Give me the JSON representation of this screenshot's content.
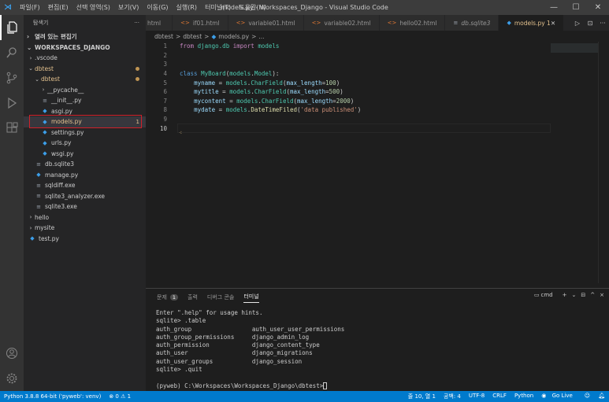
{
  "menubar": {
    "items": [
      "파일(F)",
      "편집(E)",
      "선택 영역(S)",
      "보기(V)",
      "이동(G)",
      "실행(R)",
      "터미널(T)",
      "도움말(H)"
    ],
    "window_title": "models.py - Workspaces_Django - Visual Studio Code"
  },
  "activity_icons": [
    "files-icon",
    "search-icon",
    "source-control-icon",
    "run-debug-icon",
    "extensions-icon",
    "account-icon",
    "settings-gear-icon"
  ],
  "sidebar": {
    "header": "탐색기",
    "more": "···",
    "open_editors": "열려 있는 편집기",
    "workspace": "WORKSPACES_DJANGO",
    "tree": [
      {
        "label": ".vscode",
        "indent": 1,
        "kind": "folder-closed"
      },
      {
        "label": "dbtest",
        "indent": 1,
        "kind": "folder-open",
        "modified": true
      },
      {
        "label": "dbtest",
        "indent": 2,
        "kind": "folder-open",
        "modified": true
      },
      {
        "label": "__pycache__",
        "indent": 3,
        "kind": "folder-closed"
      },
      {
        "label": "__init__.py",
        "indent": 3,
        "kind": "file"
      },
      {
        "label": "asgi.py",
        "indent": 3,
        "kind": "py"
      },
      {
        "label": "models.py",
        "indent": 3,
        "kind": "py",
        "badge": "1",
        "selected": true
      },
      {
        "label": "settings.py",
        "indent": 3,
        "kind": "py"
      },
      {
        "label": "urls.py",
        "indent": 3,
        "kind": "py"
      },
      {
        "label": "wsgi.py",
        "indent": 3,
        "kind": "py"
      },
      {
        "label": "db.sqlite3",
        "indent": 2,
        "kind": "file"
      },
      {
        "label": "manage.py",
        "indent": 2,
        "kind": "py"
      },
      {
        "label": "sqldiff.exe",
        "indent": 2,
        "kind": "file"
      },
      {
        "label": "sqlite3_analyzer.exe",
        "indent": 2,
        "kind": "file"
      },
      {
        "label": "sqlite3.exe",
        "indent": 2,
        "kind": "file"
      },
      {
        "label": "hello",
        "indent": 1,
        "kind": "folder-closed"
      },
      {
        "label": "mysite",
        "indent": 1,
        "kind": "folder-closed"
      },
      {
        "label": "test.py",
        "indent": 1,
        "kind": "py"
      }
    ]
  },
  "tabs": [
    {
      "label": "html",
      "icon": "",
      "active": false
    },
    {
      "label": "if01.html",
      "icon": "html",
      "active": false
    },
    {
      "label": "variable01.html",
      "icon": "html",
      "active": false
    },
    {
      "label": "variable02.html",
      "icon": "html",
      "active": false
    },
    {
      "label": "hello02.html",
      "icon": "html",
      "active": false
    },
    {
      "label": "db.sqlite3",
      "icon": "file",
      "active": false
    },
    {
      "label": "models.py 1",
      "icon": "py",
      "active": true
    }
  ],
  "tab_actions": [
    "▷",
    "⊡",
    "···"
  ],
  "breadcrumb": [
    "dbtest",
    ">",
    "dbtest",
    ">",
    "models.py",
    ">",
    "..."
  ],
  "code_lines": [
    {
      "n": "1",
      "html": "<span class='kw2'>from</span> <span class='cls'>django.db</span> <span class='kw2'>import</span> <span class='cls'>models</span>"
    },
    {
      "n": "2",
      "html": ""
    },
    {
      "n": "3",
      "html": ""
    },
    {
      "n": "4",
      "html": "<span class='kw'>class</span> <span class='cls'>MyBoard</span>(<span class='cls'>models</span>.<span class='cls'>Model</span>):"
    },
    {
      "n": "5",
      "html": "    <span class='var'>myname</span> = <span class='cls'>models</span>.<span class='cls'>CharField</span>(<span class='var'>max_length</span>=<span class='num'>100</span>)"
    },
    {
      "n": "6",
      "html": "    <span class='var'>mytitle</span> = <span class='cls'>models</span>.<span class='cls'>CharField</span>(<span class='var'>max_length</span>=<span class='num'>500</span>)"
    },
    {
      "n": "7",
      "html": "    <span class='var'>mycontent</span> = <span class='cls'>models</span>.<span class='cls'>CharField</span>(<span class='var'>max_length</span>=<span class='num'>2000</span>)"
    },
    {
      "n": "8",
      "html": "    <span class='var'>mydate</span> = <span class='cls'>models</span>.<span class='fn'>DateTimeFiled</span>(<span class='str'>'data published'</span>)"
    },
    {
      "n": "9",
      "html": ""
    },
    {
      "n": "10",
      "html": ""
    }
  ],
  "panel": {
    "tabs": [
      "문제",
      "출력",
      "디버그 콘솔",
      "터미널"
    ],
    "problem_count": "1",
    "terminal_name": "cmd",
    "actions": [
      "+",
      "⌄",
      "⊟",
      "^",
      "×"
    ],
    "terminal_lines": [
      "Enter \".help\" for usage hints.",
      "sqlite> .table",
      "auth_group                 auth_user_user_permissions",
      "auth_group_permissions     django_admin_log",
      "auth_permission            django_content_type",
      "auth_user                  django_migrations",
      "auth_user_groups           django_session",
      "sqlite> .quit",
      "",
      "(pyweb) C:\\Workspaces\\Workspaces_Django\\dbtest>"
    ]
  },
  "status": {
    "python": "Python 3.8.8 64-bit ('pyweb': venv)",
    "errors": "⊗ 0 ⚠ 1",
    "position": "줄 10, 열 1",
    "spaces": "공백: 4",
    "encoding": "UTF-8",
    "eol": "CRLF",
    "language": "Python",
    "golive": "Go Live"
  }
}
